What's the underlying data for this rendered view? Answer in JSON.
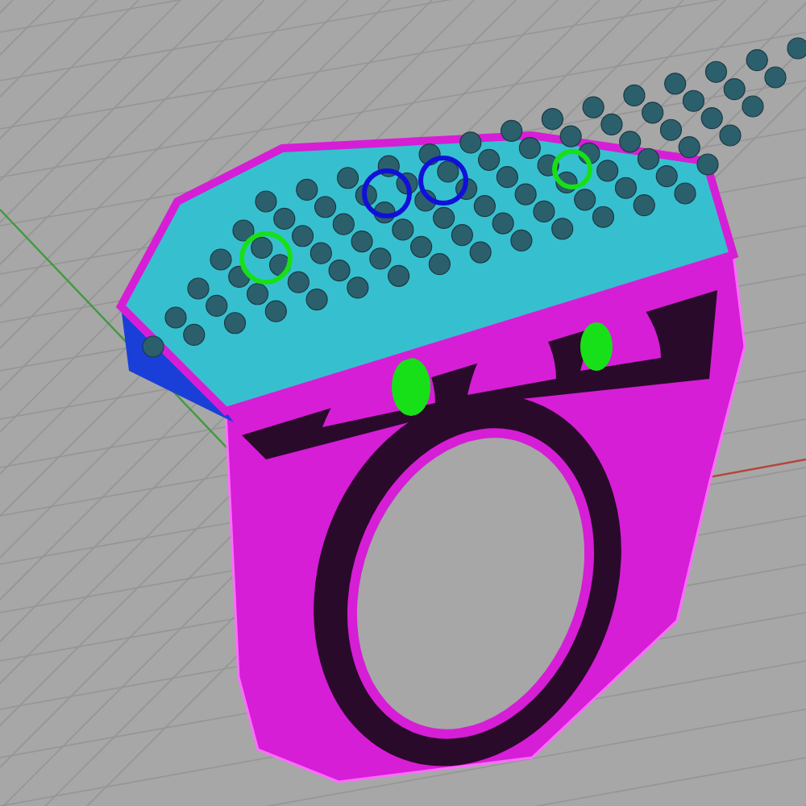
{
  "viewport": {
    "axes": [
      {
        "kind": "x",
        "color": "#b5443a"
      },
      {
        "kind": "y",
        "color": "#3f9a3f"
      }
    ]
  }
}
